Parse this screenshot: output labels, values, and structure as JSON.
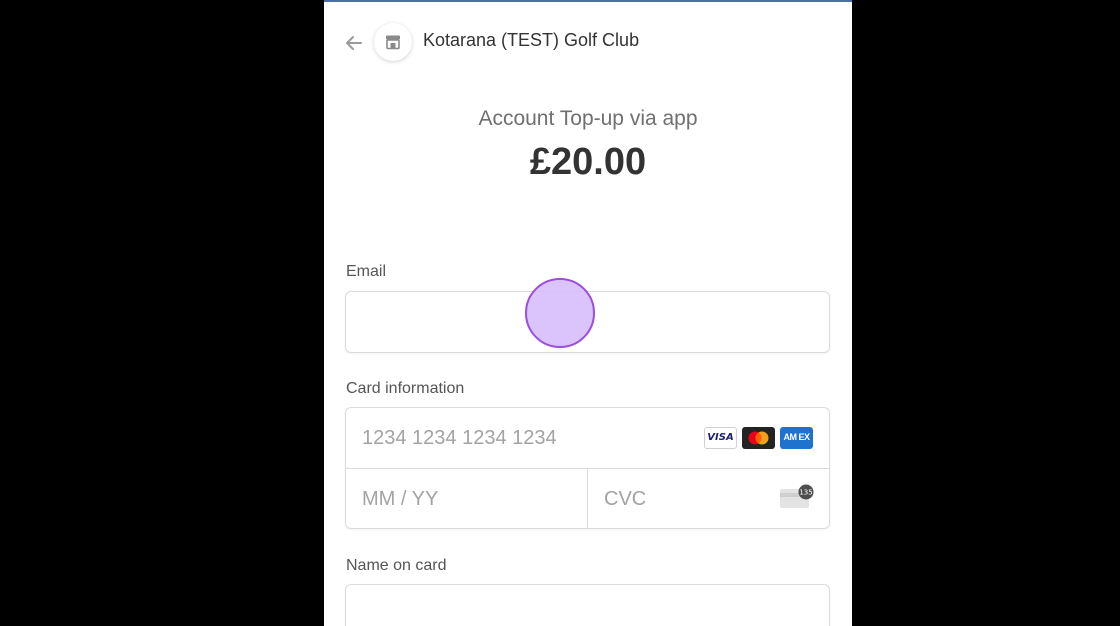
{
  "header": {
    "merchant_name": "Kotarana (TEST) Golf Club",
    "back_icon": "arrow-left-icon",
    "store_icon": "storefront-icon"
  },
  "summary": {
    "product_name": "Account Top-up via app",
    "amount": "£20.00"
  },
  "form": {
    "email": {
      "label": "Email",
      "value": "",
      "placeholder": ""
    },
    "card_information": {
      "label": "Card information",
      "number_placeholder": "1234 1234 1234 1234",
      "expiry_placeholder": "MM / YY",
      "cvc_placeholder": "CVC",
      "brands": [
        {
          "name": "visa-icon",
          "text": "VISA"
        },
        {
          "name": "mastercard-icon",
          "text": ""
        },
        {
          "name": "amex-icon",
          "text": "AM EX"
        }
      ],
      "cvc_icon": "card-cvc-icon",
      "cvc_badge": "135"
    },
    "name_on_card": {
      "label": "Name on card",
      "value": "",
      "placeholder": ""
    }
  },
  "colors": {
    "background": "#000000",
    "panel": "#ffffff",
    "touch_fill": "#d7befc",
    "touch_border": "#9b4dde",
    "visa_blue": "#1a1f71",
    "amex_blue": "#1f72cd"
  }
}
